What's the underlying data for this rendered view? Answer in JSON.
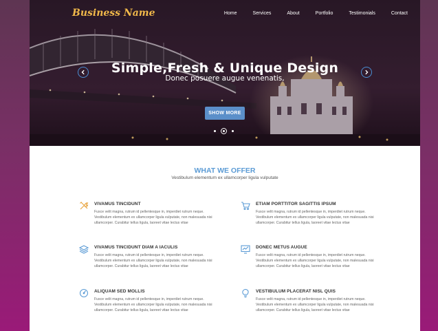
{
  "nav": {
    "brand": "Business Name",
    "links": [
      "Home",
      "Services",
      "About",
      "Portfolio",
      "Testimonials",
      "Contact"
    ]
  },
  "hero": {
    "title": "Simple,Fresh & Unique Design",
    "subtitle": "Donec posuere augue venenatis,",
    "button": "SHOW MORE",
    "slides": 3,
    "active_slide": 2
  },
  "offer": {
    "title": "WHAT WE OFFER",
    "subtitle": "Vestibulum elementum ex ullamcorper ligula vulputate",
    "features": [
      {
        "icon": "tools-icon",
        "title": "VIVAMUS TINCIDUNT",
        "text": "Fusce velit magna, rutrum id pellentesque in, imperdiet rutrum neque. Vestibulum elementum ex ullamcorper ligula vulputate, non malesuada nisi ullamcorper. Curabitur tellus ligula, laoreet vitae lectus vitae"
      },
      {
        "icon": "cart-icon",
        "title": "ETIAM PORTTITOR SAGITTIS IPSUM",
        "text": "Fusce velit magna, rutrum id pellentesque in, imperdiet rutrum neque. Vestibulum elementum ex ullamcorper ligula vulputate, non malesuada nisi ullamcorper. Curabitur tellus ligula, laoreet vitae lectus vitae"
      },
      {
        "icon": "layers-icon",
        "title": "VIVAMUS TINCIDUNT DIAM A IACULIS",
        "text": "Fusce velit magna, rutrum id pellentesque in, imperdiet rutrum neque. Vestibulum elementum ex ullamcorper ligula vulputate, non malesuada nisi ullamcorper. Curabitur tellus ligula, laoreet vitae lectus vitae"
      },
      {
        "icon": "chart-screen-icon",
        "title": "DONEC METUS AUGUE",
        "text": "Fusce velit magna, rutrum id pellentesque in, imperdiet rutrum neque. Vestibulum elementum ex ullamcorper ligula vulputate, non malesuada nisi ullamcorper. Curabitur tellus ligula, laoreet vitae lectus vitae"
      },
      {
        "icon": "gauge-icon",
        "title": "ALIQUAM SED MOLLIS",
        "text": "Fusce velit magna, rutrum id pellentesque in, imperdiet rutrum neque. Vestibulum elementum ex ullamcorper ligula vulputate, non malesuada nisi ullamcorper. Curabitur tellus ligula, laoreet vitae lectus vitae"
      },
      {
        "icon": "lightbulb-icon",
        "title": "VESTIBULUM PLACERAT NISL QUIS",
        "text": "Fusce velit magna, rutrum id pellentesque in, imperdiet rutrum neque. Vestibulum elementum ex ullamcorper ligula vulputate, non malesuada nisi ullamcorper. Curabitur tellus ligula, laoreet vitae lectus vitae"
      }
    ]
  },
  "colors": {
    "accent": "#5b9bd5",
    "brand": "#f0b84a",
    "button": "#5b8fc9",
    "background_outer": "#7a2f66"
  }
}
